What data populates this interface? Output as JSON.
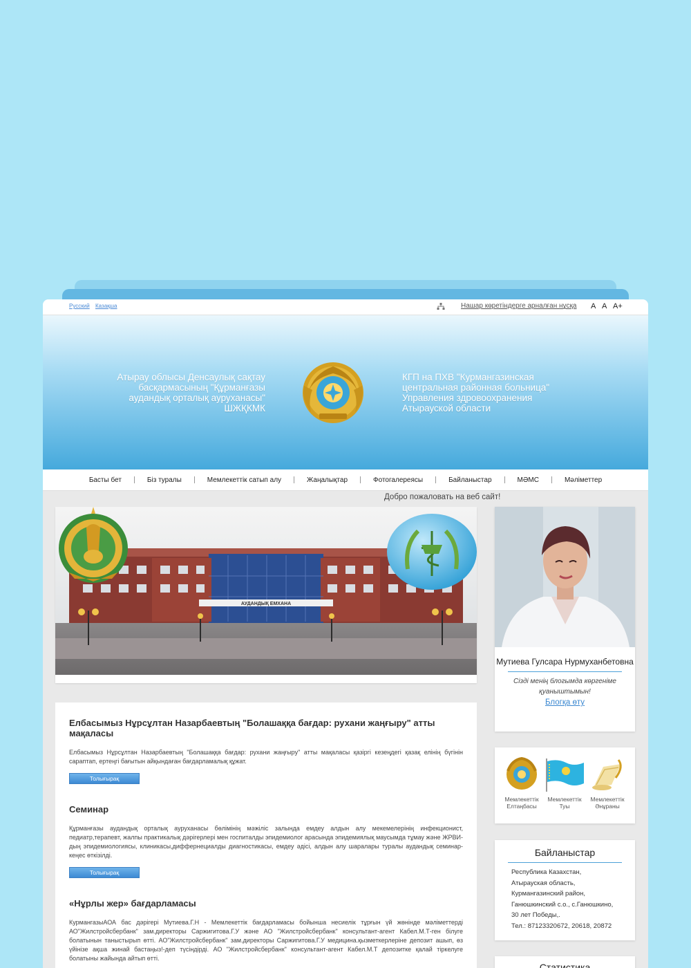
{
  "top_bar": {
    "lang_ru": "Русский",
    "lang_kz": "Казақша",
    "low_vision": "Нашар көретіндерге арналған нұсқа",
    "font_sizes": [
      "A",
      "A",
      "A+"
    ]
  },
  "header": {
    "left_title": "Атырау облысы Денсаулық сақтау басқармасының \"Құрманғазы аудандық орталық ауруханасы\" ШЖҚКМК",
    "right_title": "КГП на ПХВ \"Курмангазинская центральная районная больница\" Управления здровоохранения Атырауской области"
  },
  "nav": {
    "items": [
      "Басты бет",
      "Біз туралы",
      "Мемлекеттік сатып алу",
      "Жаңалықтар",
      "Фотогалереясы",
      "Байланыстар",
      "МӘМС",
      "Мәліметтер"
    ]
  },
  "welcome": "Добро пожаловать на веб сайт!",
  "banner": {
    "building_sign": "АУДАНДЫҚ ЕМХАНА"
  },
  "news": [
    {
      "title": "Елбасымыз Нұрсұлтан Назарбаевтың \"Болашаққа бағдар: рухани жаңғыру\" атты мақаласы",
      "text": "Елбасымыз Нұрсұлтан Назарбаевтың \"Болашаққа бағдар: рухани жаңғыру\" атты мақаласы қазіргі кезеңдегі қазақ елінің бүгінін сараптап, ертеңгі бағытын айқындаған бағдарламалық құжат.",
      "button": "Толығырақ"
    },
    {
      "title": "Семинар",
      "text": "Құрманғазы аудандық орталық ауруханасы бөлімінің мәжіліс залында емдеу алдын алу мекемелерінің инфекционист, педиатр,терапевт, жалпы практикалық дәрігерлері мен госпиталды эпидемиолог арасында эпидемиялық маусымда тұмау және ЖРВИ-дың эпидемиологиясы, клиникасы,диффернециалды диагностикасы, емдеу әдісі, алдын алу шаралары туралы аудандық семинар-кеңес өткізілді.",
      "button": "Толығырақ"
    },
    {
      "title": "«Нұрлы жер» бағдарламасы",
      "text": "КурмангазыАОА бас дәрігері Мутиева.Г.Н - Мемлекеттік бағдарламасы бойынша несиелік тұрғын үй жөнінде мәліметтерді АО\"Жилстройсбербанк\" зам.директоры Саржигитова.Г.У және АО \"Жилстройсбербанк\" консультант-агент Кабел.М.Т-ген білуге болатынын таныстырып өтті. АО\"Жилстройсбербанк\" зам.директоры Саржигитова.Г.У медицина.қызметкерлеріне депозит ашып, өз үйінізе ақша жинай бастаңыз!-деп түсіндірді. АО \"Жилстройсбербанк\" консультант-агент Кабел.М.Т депозитке қалай тіркелуге болатыны жайында айтып өтті."
    }
  ],
  "profile": {
    "name": "Мутиева Гулсара Нурмуханбетовна",
    "message": "Сізді менің блогымда көргеніме қуаныштымын!",
    "blog_link": "Блогқа өту"
  },
  "symbols": [
    {
      "label": "Мемлекеттік Елтаңбасы",
      "icon": "state-emblem-icon"
    },
    {
      "label": "Мемлекеттік Туы",
      "icon": "state-flag-icon"
    },
    {
      "label": "Мемлекеттік Әнұраны",
      "icon": "state-anthem-icon"
    }
  ],
  "contacts": {
    "title": "Байланыстар",
    "lines": [
      "Республика Казахстан,",
      "Атырауская область,",
      "Курмангазинский район,",
      "Ганюшкинский с.о., с.Ганюшкино,",
      "30 лет Победы,.",
      "Тел.: 87123320672, 20618, 20872"
    ]
  },
  "stats": {
    "title": "Статистика"
  },
  "colors": {
    "background": "#ade6f7",
    "header_blue": "#45a9dc",
    "link": "#3a87d0",
    "button": "#3d8ad4"
  }
}
